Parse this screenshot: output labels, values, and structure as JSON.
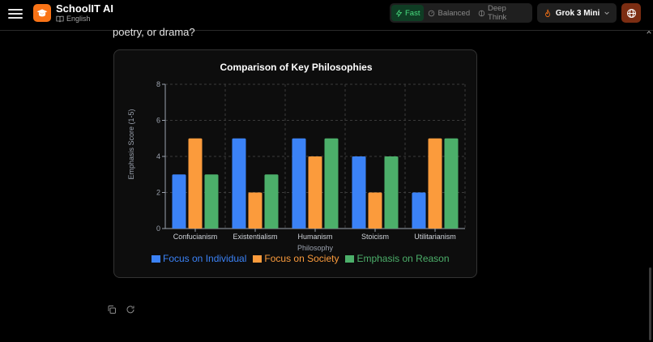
{
  "app": {
    "title": "SchoolIT AI",
    "language": "English"
  },
  "modes": [
    {
      "label": "Fast",
      "icon": "lightning-icon",
      "active": true
    },
    {
      "label": "Balanced",
      "icon": "gauge-icon",
      "active": false
    },
    {
      "label": "Deep Think",
      "icon": "brain-icon",
      "active": false
    }
  ],
  "model": {
    "label": "Grok 3 Mini",
    "icon": "flame-icon"
  },
  "message": {
    "text": "poetry, or drama?"
  },
  "colors": {
    "individual": "#3b82f6",
    "society": "#fb9b3c",
    "reason": "#4caf6a",
    "accent": "#f97316"
  },
  "chart_data": {
    "type": "bar",
    "title": "Comparison of Key Philosophies",
    "xlabel": "Philosophy",
    "ylabel": "Emphasis Score (1-5)",
    "ylim": [
      0,
      8
    ],
    "yticks": [
      0,
      2,
      4,
      6,
      8
    ],
    "grid": true,
    "legend_position": "bottom",
    "categories": [
      "Confucianism",
      "Existentialism",
      "Humanism",
      "Stoicism",
      "Utilitarianism"
    ],
    "series": [
      {
        "name": "Focus on Individual",
        "values": [
          3,
          5,
          5,
          4,
          2
        ],
        "color": "#3b82f6"
      },
      {
        "name": "Focus on Society",
        "values": [
          5,
          2,
          4,
          2,
          5
        ],
        "color": "#fb9b3c"
      },
      {
        "name": "Emphasis on Reason",
        "values": [
          3,
          3,
          5,
          4,
          5
        ],
        "color": "#4caf6a"
      }
    ]
  }
}
